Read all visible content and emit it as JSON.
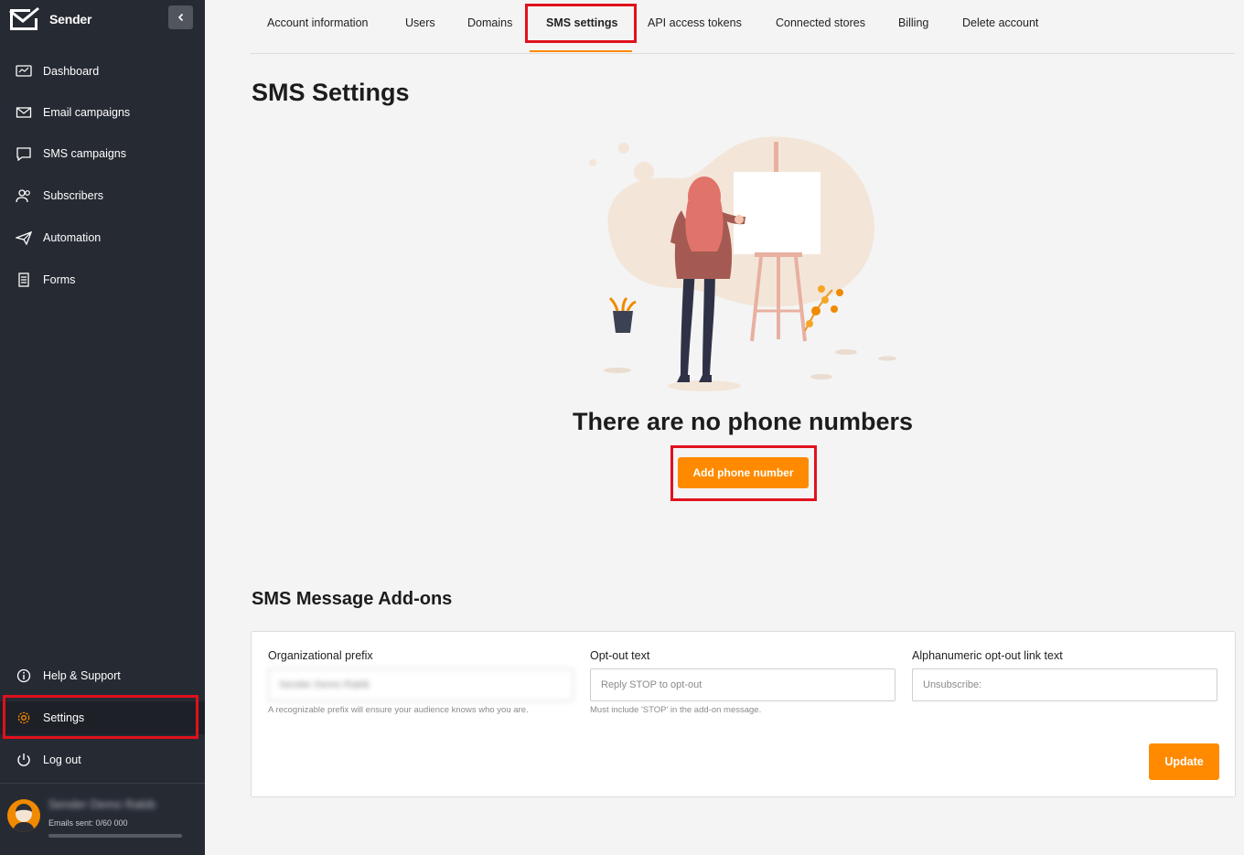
{
  "sidebar": {
    "brand": "Sender",
    "items": [
      {
        "label": "Dashboard"
      },
      {
        "label": "Email campaigns"
      },
      {
        "label": "SMS campaigns"
      },
      {
        "label": "Subscribers"
      },
      {
        "label": "Automation"
      },
      {
        "label": "Forms"
      }
    ],
    "bottom_items": [
      {
        "label": "Help & Support"
      },
      {
        "label": "Settings"
      },
      {
        "label": "Log out"
      }
    ],
    "user": {
      "name": "Sender Demo Rakib",
      "emails_sent": "Emails sent: 0/60 000",
      "usage_fraction": 0
    }
  },
  "tabs": [
    {
      "label": "Account information"
    },
    {
      "label": "Users"
    },
    {
      "label": "Domains"
    },
    {
      "label": "SMS settings"
    },
    {
      "label": "API access tokens"
    },
    {
      "label": "Connected stores"
    },
    {
      "label": "Billing"
    },
    {
      "label": "Delete account"
    }
  ],
  "active_tab": "SMS settings",
  "main": {
    "title": "SMS Settings",
    "empty_state": "There are no phone numbers",
    "add_button": "Add phone number"
  },
  "addons": {
    "title": "SMS Message Add-ons",
    "fields": [
      {
        "label": "Organizational prefix",
        "value": "Sender Demo Rakib",
        "placeholder": "",
        "hint": "A recognizable prefix will ensure your audience knows who you are."
      },
      {
        "label": "Opt-out text",
        "value": "",
        "placeholder": "Reply STOP to opt-out",
        "hint": "Must include 'STOP' in the add-on message."
      },
      {
        "label": "Alphanumeric opt-out link text",
        "value": "",
        "placeholder": "Unsubscribe:",
        "hint": ""
      }
    ],
    "update_button": "Update"
  },
  "colors": {
    "accent": "#ff8a00",
    "sidebar_bg": "#262a33",
    "highlight": "#e0111c"
  }
}
